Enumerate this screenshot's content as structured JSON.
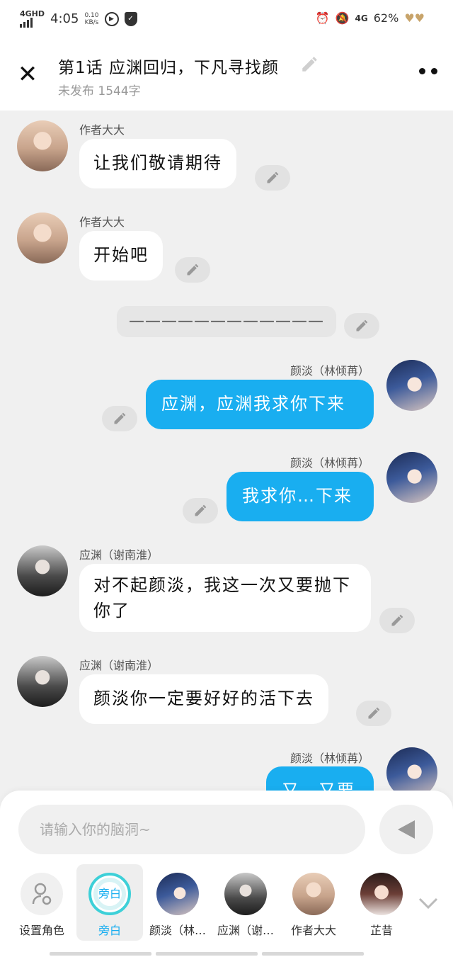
{
  "status_bar": {
    "network": "4GHD",
    "time": "4:05",
    "speed_top": "0.10",
    "speed_bottom": "KB/s",
    "right_network": "4G",
    "battery": "62%"
  },
  "header": {
    "title": "第1话  应渊回归，下凡寻找颜",
    "subtitle": "未发布 1544字",
    "close_icon": "close-icon",
    "more_icon": "more-icon"
  },
  "messages": [
    {
      "speaker": "作者大大",
      "text": "让我们敬请期待",
      "side": "left"
    },
    {
      "speaker": "作者大大",
      "text": "开始吧",
      "side": "left"
    },
    {
      "speaker": "",
      "text": "————————————",
      "side": "narration"
    },
    {
      "speaker": "颜淡（林倾苒）",
      "text": "应渊，应渊我求你下来",
      "side": "right"
    },
    {
      "speaker": "颜淡（林倾苒）",
      "text": "我求你…下来",
      "side": "right"
    },
    {
      "speaker": "应渊（谢南淮）",
      "text": "对不起颜淡，我这一次又要抛下你了",
      "side": "left"
    },
    {
      "speaker": "应渊（谢南淮）",
      "text": "颜淡你一定要好好的活下去",
      "side": "left"
    },
    {
      "speaker": "颜淡（林倾苒）",
      "text": "又…又要",
      "side": "right"
    }
  ],
  "composer": {
    "placeholder": "请输入你的脑洞~",
    "send_icon": "send-icon"
  },
  "roles": [
    {
      "label": "设置角色",
      "icon": "person-settings-icon"
    },
    {
      "label": "旁白",
      "avatar_text": "旁白",
      "active": true
    },
    {
      "label": "颜淡（林…"
    },
    {
      "label": "应渊（谢…"
    },
    {
      "label": "作者大大"
    },
    {
      "label": "芷昔"
    }
  ],
  "colors": {
    "accent": "#19aef0",
    "background": "#f0f0f0"
  }
}
